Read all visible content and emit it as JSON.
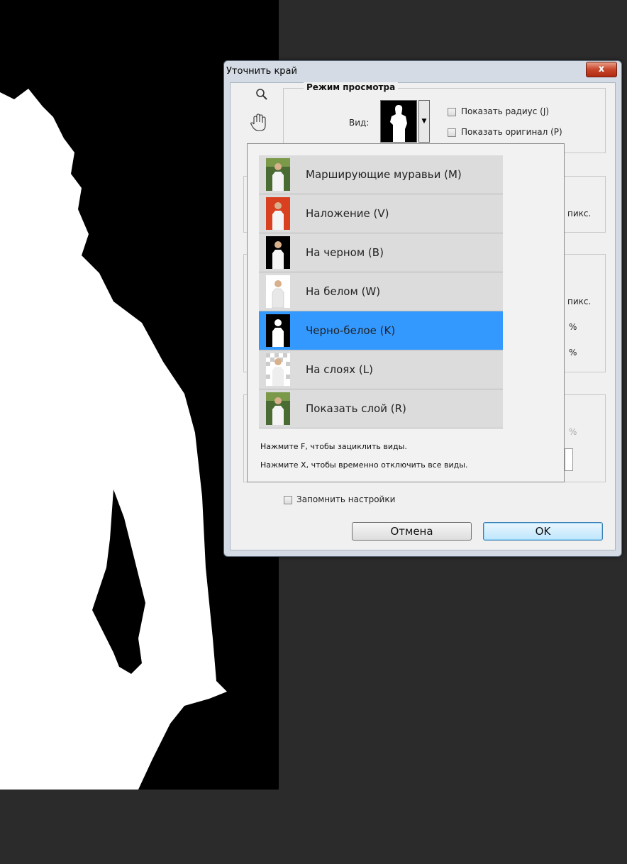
{
  "dialog": {
    "title": "Уточнить край",
    "close_symbol": "x"
  },
  "tools": {
    "zoom_icon": "magnifier-icon",
    "hand_icon": "hand-icon"
  },
  "view_mode": {
    "group_title": "Режим просмотра",
    "view_label": "Вид:",
    "show_radius": "Показать радиус (J)",
    "show_original": "Показать оригинал (P)"
  },
  "partial_labels": {
    "pix1": "пикс.",
    "pix2": "пикс.",
    "pct1": "%",
    "pct2": "%",
    "pct3": "%"
  },
  "view_menu": {
    "options": [
      {
        "label": "Марширующие муравьи (M)",
        "thumb": "color-photo"
      },
      {
        "label": "Наложение (V)",
        "thumb": "red-overlay"
      },
      {
        "label": "На черном (B)",
        "thumb": "on-black"
      },
      {
        "label": "На белом (W)",
        "thumb": "on-white"
      },
      {
        "label": "Черно-белое (K)",
        "thumb": "black-white",
        "selected": true
      },
      {
        "label": "На слоях (L)",
        "thumb": "on-layers"
      },
      {
        "label": "Показать слой (R)",
        "thumb": "color-photo"
      }
    ],
    "hint1": "Нажмите F, чтобы зациклить виды.",
    "hint2": "Нажмите X, чтобы временно отключить все виды."
  },
  "footer": {
    "remember": "Запомнить настройки",
    "cancel": "Отмена",
    "ok": "OK"
  },
  "colors": {
    "selected": "#3399ff",
    "option_bg": "#dcdcdc"
  }
}
